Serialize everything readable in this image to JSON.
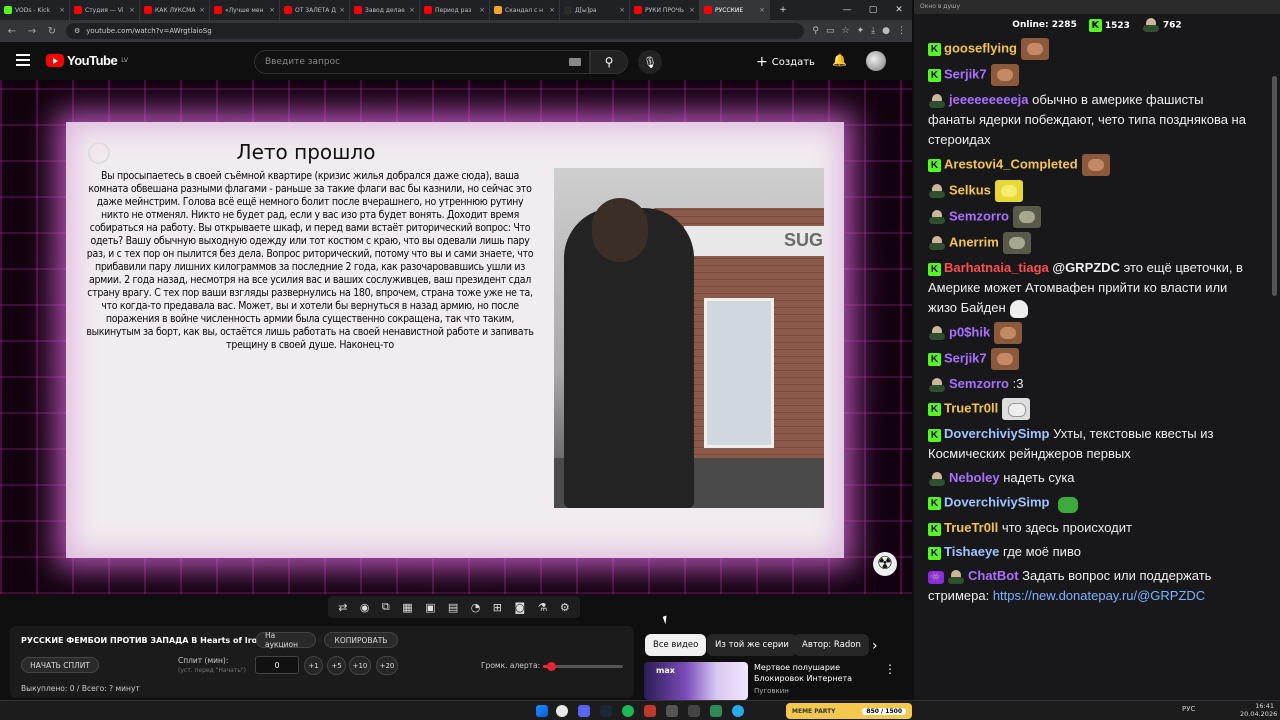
{
  "browser": {
    "tabs": [
      {
        "label": "VODs - Kick",
        "color": "#53fc18"
      },
      {
        "label": "Студия — Vi",
        "color": "#ff0000"
      },
      {
        "label": "КАК ЛУКСМА",
        "color": "#ff0000"
      },
      {
        "label": "«Лучше мен",
        "color": "#ff0000"
      },
      {
        "label": "ОТ ЗАЛЕТА Д",
        "color": "#ff0000"
      },
      {
        "label": "Завод делае",
        "color": "#ff0000"
      },
      {
        "label": "Период раз",
        "color": "#ff0000"
      },
      {
        "label": "Скандал с н",
        "color": "#f5a623"
      },
      {
        "label": "Д[ы]ра",
        "color": "#2b2b2b"
      },
      {
        "label": "РУКИ ПРОЧЬ",
        "color": "#ff0000"
      },
      {
        "label": "РУССКИЕ",
        "color": "#ff0000",
        "active": true
      }
    ],
    "url": "youtube.com/watch?v=AWrgtlaioSg"
  },
  "youtube": {
    "logo_text": "YouTube",
    "logo_region": "LV",
    "search_placeholder": "Введите запрос",
    "create_label": "Создать"
  },
  "video": {
    "card_title": "Лето прошло",
    "card_body": "Вы просыпаетесь в своей съёмной квартире (кризис жилья добрался даже сюда), ваша комната обвешана разными флагами - раньше за такие флаги вас бы казнили, но сейчас это даже мейнстрим. Голова всё ещё немного болит после вчерашнего, но утреннюю рутину никто не отменял. Никто не будет рад, если у вас изо рта будет вонять. Доходит время собираться на работу. Вы открываете шкаф, и перед вами встаёт риторический вопрос: Что одеть? Вашу обычную выходную одежду или тот костюм с краю, что вы одевали лишь пару раз, и с тех пор он пылится без дела. Вопрос риторический, потому что вы и сами знаете, что прибавили пару лишних килограммов за последние 2 года, как разочаровавшись ушли из армии. 2 года назад, несмотря на все усилия вас и ваших сослуживцев, ваш президент сдал страну врагу. С тех пор ваши взгляды развернулись на 180, впрочем, страна тоже уже не та, что когда-то предавала вас. Может, вы и хотели бы вернуться в назад армию, но после поражения в войне численность армии была существенно сокращена, так что таким, выкинутым за борт, как вы, остаётся лишь работать на своей ненавистной работе и запивать трещину в своей душе. Наконец-то",
    "photo_sign": "SUG"
  },
  "panel": {
    "title": "РУССКИЕ ФЕМБОИ ПРОТИВ ЗАПАДА В Hearts of Iron IV",
    "auction_btn": "На аукцион",
    "copy_btn": "КОПИРОВАТЬ",
    "start_split_btn": "НАЧАТЬ СПЛИТ",
    "split_label": "Сплит (мин):",
    "split_sub": "(уст. перед \"Начать\")",
    "split_value": "0",
    "inc_buttons": [
      "+1",
      "+5",
      "+10",
      "+20"
    ],
    "volume_label": "Громк. алерта:",
    "volume_level": 0.1,
    "paid_text": "Выкуплено: 0 / Всего: ? минут"
  },
  "recommendations": {
    "chips": [
      "Все видео",
      "Из той же серии",
      "Автор: Radon"
    ],
    "video": {
      "thumb_text": "max",
      "title": "Мертвое полушарие Блокировок Интернета",
      "channel": "Пуговкин"
    }
  },
  "chat": {
    "window_title": "Окно в душу",
    "online_label": "Online:",
    "online_count": "2285",
    "kick_count": "1523",
    "other_count": "762",
    "messages": [
      {
        "badge": "kick",
        "user": "gooseflying",
        "color": "#f5c542",
        "text": "",
        "emote": "brown"
      },
      {
        "badge": "kick",
        "user": "Serjik7",
        "color": "#a970ff",
        "text": "",
        "emote": "brown"
      },
      {
        "badge": "avatar",
        "user": "jeeeeeeeeeja",
        "color": "#a970ff",
        "text": "обычно в америке фашисты фанаты ядерки побеждают, чето типа позднякова на стероидах"
      },
      {
        "badge": "kick",
        "user": "Arestovi4_Completed",
        "color": "#f5c542",
        "text": "",
        "emote": "brown"
      },
      {
        "badge": "avatar",
        "user": "Selkus",
        "color": "#f5c542",
        "text": "",
        "emote": "yellow"
      },
      {
        "badge": "avatar",
        "user": "Semzorro",
        "color": "#a970ff",
        "text": "",
        "emote": "grey"
      },
      {
        "badge": "avatar",
        "user": "Anerrim",
        "color": "#f5c542",
        "text": "",
        "emote": "grey"
      },
      {
        "badge": "kick",
        "user": "Barhatnaia_tiaga",
        "color": "#ff4d4d",
        "mention": "@GRPZDC",
        "text": "это ещё цветочки, в Америке может Атомвафен прийти ко власти или жизо Байден",
        "skull": true
      },
      {
        "badge": "avatar",
        "user": "p0$hik",
        "color": "#a970ff",
        "text": "",
        "emote": "brown"
      },
      {
        "badge": "kick",
        "user": "Serjik7",
        "color": "#a970ff",
        "text": "",
        "emote": "brown"
      },
      {
        "badge": "avatar",
        "user": "Semzorro",
        "color": "#a970ff",
        "text": ":3"
      },
      {
        "badge": "kick",
        "user": "TrueTr0ll",
        "color": "#f5c542",
        "text": "",
        "emote": "cat"
      },
      {
        "badge": "kick",
        "user": "DoverchiviySimp",
        "color": "#a0c4ff",
        "text": "Ухты, текстовые квесты из Космических рейнджеров первых"
      },
      {
        "badge": "avatar",
        "user": "Neboley",
        "color": "#a970ff",
        "text": "надеть сука"
      },
      {
        "badge": "kick",
        "user": "DoverchiviySimp",
        "color": "#a0c4ff",
        "text": "",
        "emote": "frog"
      },
      {
        "badge": "kick",
        "user": "TrueTr0ll",
        "color": "#f5c542",
        "text": "что здесь происходит"
      },
      {
        "badge": "kick",
        "user": "Tishaeye",
        "color": "#a0c4ff",
        "text": "где моё пиво"
      },
      {
        "badge": "bot",
        "user": "ChatBot",
        "color": "#a970ff",
        "text": "Задать вопрос или поддержать стримера:",
        "link": "https://new.donatepay.ru/@GRPZDC"
      }
    ]
  },
  "taskbar": {
    "widget_name": "MEME PARTY",
    "widget_progress": "850 / 1500",
    "lang": "РУС",
    "time": "16:41",
    "date": "20.04.2026"
  }
}
